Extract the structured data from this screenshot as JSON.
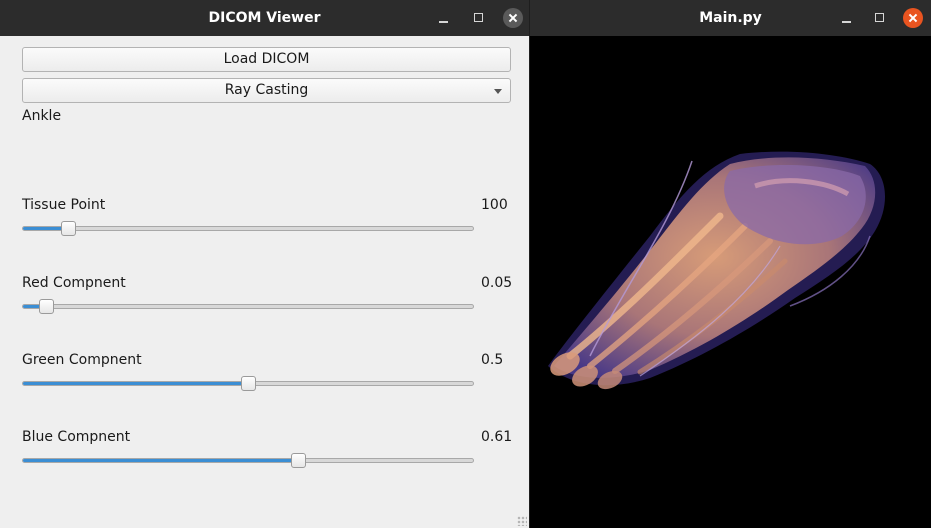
{
  "viewer_window": {
    "title": "DICOM Viewer",
    "load_button_label": "Load DICOM",
    "render_mode": {
      "selected": "Ray Casting"
    },
    "dataset_label": "Ankle",
    "sliders": [
      {
        "label": "Tissue Point",
        "value_text": "100",
        "level": 0.1
      },
      {
        "label": "Red Compnent",
        "value_text": "0.05",
        "level": 0.05
      },
      {
        "label": "Green Compnent",
        "value_text": "0.5",
        "level": 0.5
      },
      {
        "label": "Blue Compnent",
        "value_text": "0.61",
        "level": 0.61
      }
    ]
  },
  "render_window": {
    "title": "Main.py"
  },
  "colors": {
    "accent": "#3b8ed4",
    "close_button": "#e95420",
    "titlebar": "#2c2c2c",
    "render_bone": "#c98b6b",
    "render_tissue": "#5c4a9a"
  },
  "icons": {
    "minimize": "minimize-icon",
    "maximize": "maximize-icon",
    "close": "close-icon",
    "dropdown": "chevron-down-icon"
  }
}
